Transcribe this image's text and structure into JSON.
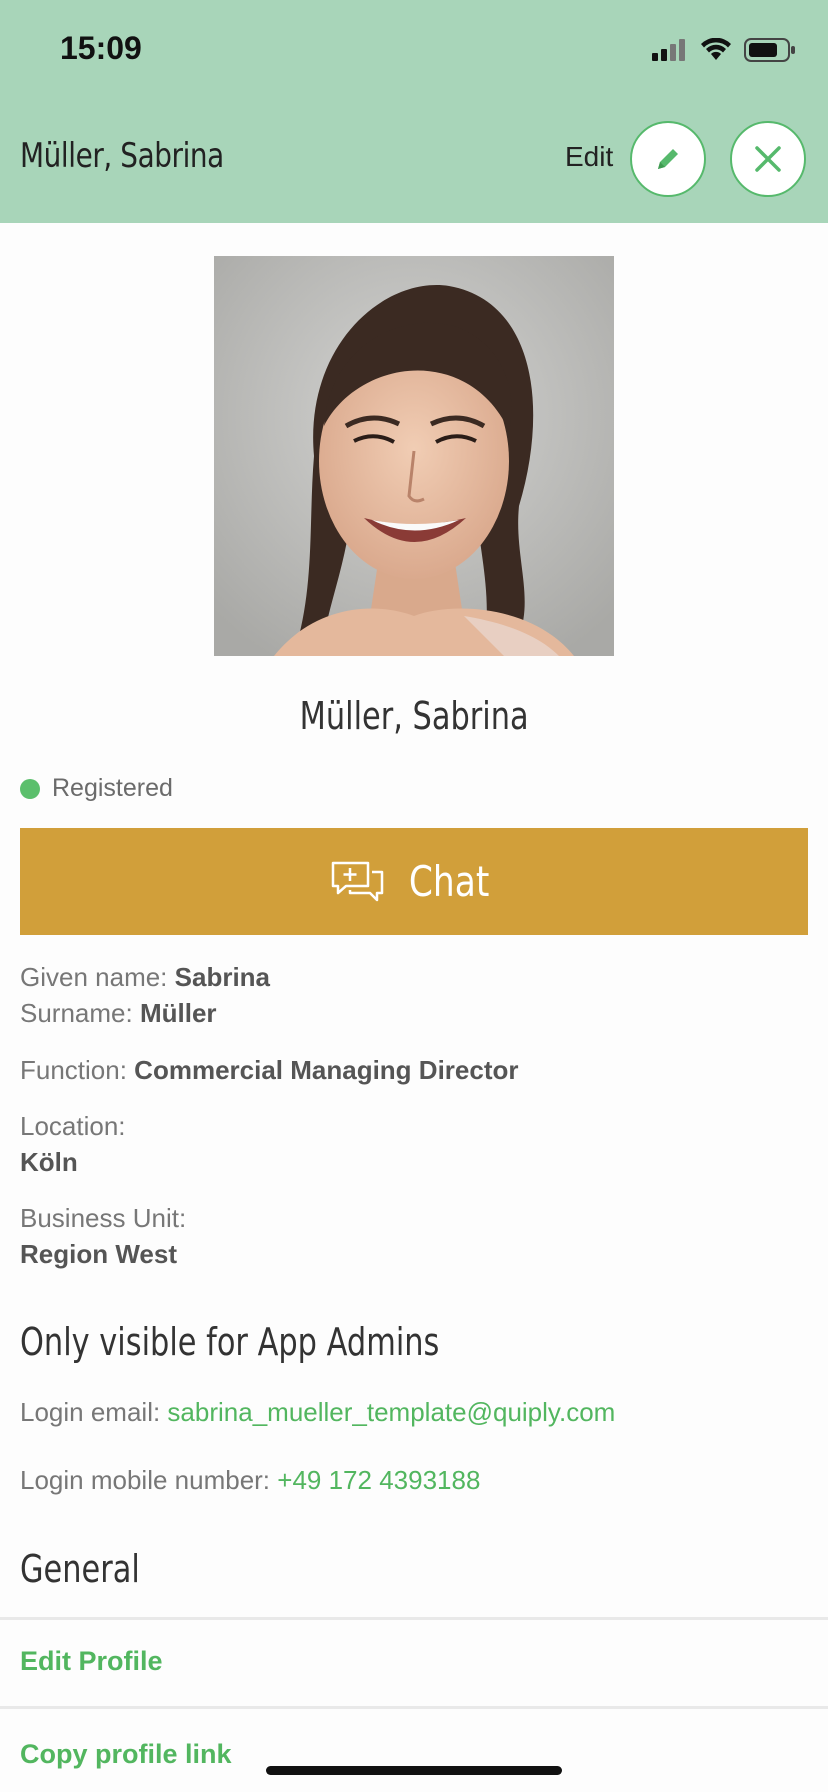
{
  "status_bar": {
    "time": "15:09"
  },
  "nav": {
    "title": "Müller, Sabrina",
    "edit_label": "Edit"
  },
  "profile": {
    "display_name": "Müller, Sabrina",
    "status": "Registered",
    "status_color": "#5bbf6c",
    "chat_label": "Chat"
  },
  "fields": {
    "given_name_label": "Given name: ",
    "given_name": "Sabrina",
    "surname_label": "Surname: ",
    "surname": "Müller",
    "function_label": "Function: ",
    "function": "Commercial Managing Director",
    "location_label": "Location:",
    "location": "Köln",
    "business_unit_label": "Business Unit:",
    "business_unit": "Region West"
  },
  "admin": {
    "title": "Only visible for App Admins",
    "email_label": "Login email: ",
    "email": "sabrina_mueller_template@quiply.com",
    "mobile_label": "Login mobile number: ",
    "mobile": "+49 172 4393188"
  },
  "general": {
    "title": "General",
    "items": [
      "Edit Profile",
      "Copy profile link"
    ]
  },
  "colors": {
    "header_bg": "#a8d5b9",
    "accent": "#52b65f",
    "chat_bg": "#d19f3a"
  },
  "icons": [
    "signal-icon",
    "wifi-icon",
    "battery-icon",
    "pencil-icon",
    "close-icon",
    "chat-bubbles-icon"
  ]
}
